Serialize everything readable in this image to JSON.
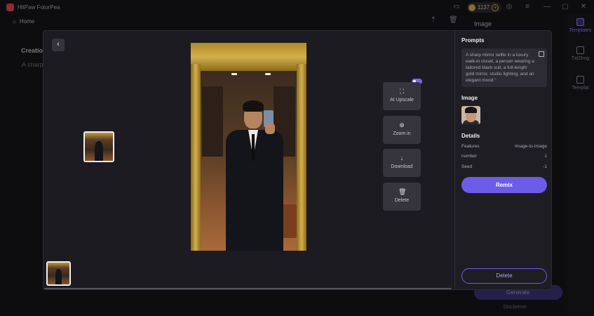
{
  "app": {
    "title": "HitPaw FotorPea",
    "credits": "1137",
    "home_label": "Home",
    "bg_creation_label": "Creatio",
    "bg_prompt_snippet": "A sharp",
    "bg_image_label": "Image"
  },
  "rail": {
    "items": [
      {
        "label": "Templates"
      },
      {
        "label": "Txt2Img"
      },
      {
        "label": "Templat"
      }
    ]
  },
  "bg_generate": {
    "label": "Generate",
    "disclaimer": "Disclaimer"
  },
  "modal": {
    "actions": [
      {
        "label": "AI Upscale",
        "icon": "upscale-icon"
      },
      {
        "label": "Zoom in",
        "icon": "zoom-in-icon"
      },
      {
        "label": "Download",
        "icon": "download-icon"
      },
      {
        "label": "Delete",
        "icon": "trash-icon"
      }
    ],
    "side": {
      "prompts_title": "Prompts",
      "prompt_text": "A sharp mirror selfie in a luxury walk-in closet, a person wearing a tailored black suit, a full-length gold mirror, studio lighting, and an elegant mood.\"",
      "image_title": "Image",
      "details_title": "Details",
      "details": [
        {
          "label": "Features",
          "value": "Image-to-Image"
        },
        {
          "label": "number",
          "value": "1"
        },
        {
          "label": "Seed",
          "value": "-1"
        }
      ],
      "remix_label": "Remix",
      "delete_label": "Delete"
    }
  },
  "colors": {
    "accent": "#6c5ce7",
    "panel": "#1f1d24",
    "modal": "#1d1b22"
  }
}
